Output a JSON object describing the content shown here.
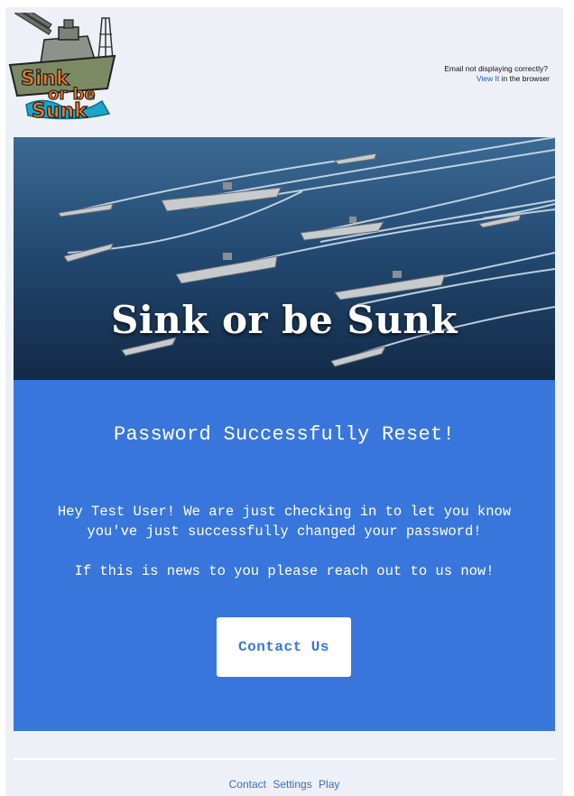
{
  "header": {
    "logo_text_line1": "Sink",
    "logo_text_line2": "or be",
    "logo_text_line3": "Sunk",
    "view_online_prefix": "Email not displaying correctly?",
    "view_online_link": "View It",
    "view_online_suffix": "in the browser"
  },
  "hero": {
    "title": "Sink or be Sunk",
    "sea_color": "#21476f"
  },
  "content": {
    "background_color": "#3876dc",
    "heading": "Password Successfully Reset!",
    "message_line1": "Hey Test User! We are just checking in to let you know you've just successfully changed your password!",
    "message_line2": "If this is news to you please reach out to us now!",
    "button_label": "Contact Us"
  },
  "footer": {
    "links": [
      "Contact",
      "Settings",
      "Play"
    ]
  }
}
